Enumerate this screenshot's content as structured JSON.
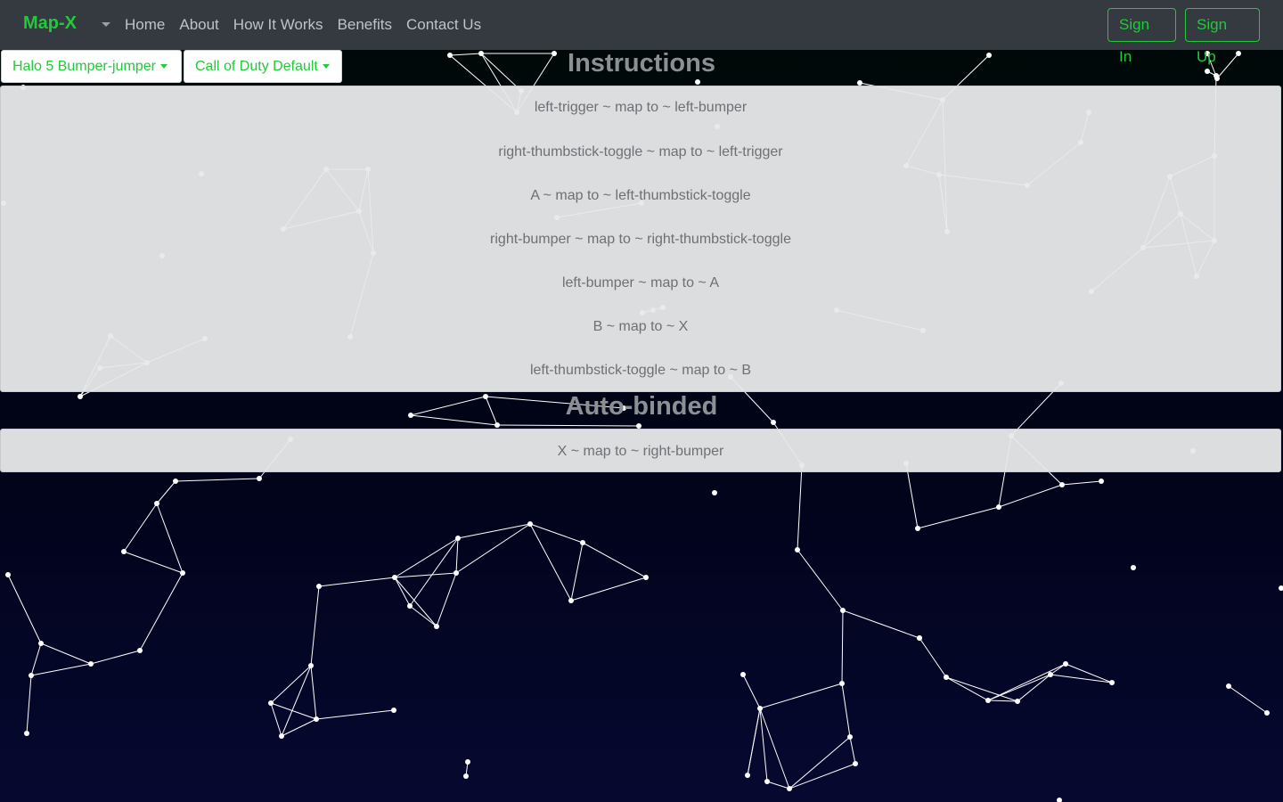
{
  "navbar": {
    "brand": "Map-X",
    "links": [
      "Home",
      "About",
      "How It Works",
      "Benefits",
      "Contact Us"
    ],
    "sign_in": "Sign In",
    "sign_up": "Sign Up"
  },
  "selectors": {
    "source_profile": "Halo 5 Bumper-jumper",
    "target_profile": "Call of Duty Default"
  },
  "instructions": {
    "title": "Instructions",
    "items": [
      "left-trigger ~ map to ~ left-bumper",
      "right-thumbstick-toggle ~ map to ~ left-trigger",
      "A ~ map to ~ left-thumbstick-toggle",
      "right-bumper ~ map to ~ right-thumbstick-toggle",
      "left-bumper ~ map to ~ A",
      "B ~ map to ~ X",
      "left-thumbstick-toggle ~ map to ~ B"
    ]
  },
  "auto_binded": {
    "title": "Auto-binded",
    "items": [
      "X ~ map to ~ right-bumper"
    ]
  },
  "colors": {
    "accent": "#22c93a",
    "navbar": "#343a40",
    "panel": "#e7e9ea",
    "panel_text": "#6d7175",
    "heading": "#8c9095"
  }
}
